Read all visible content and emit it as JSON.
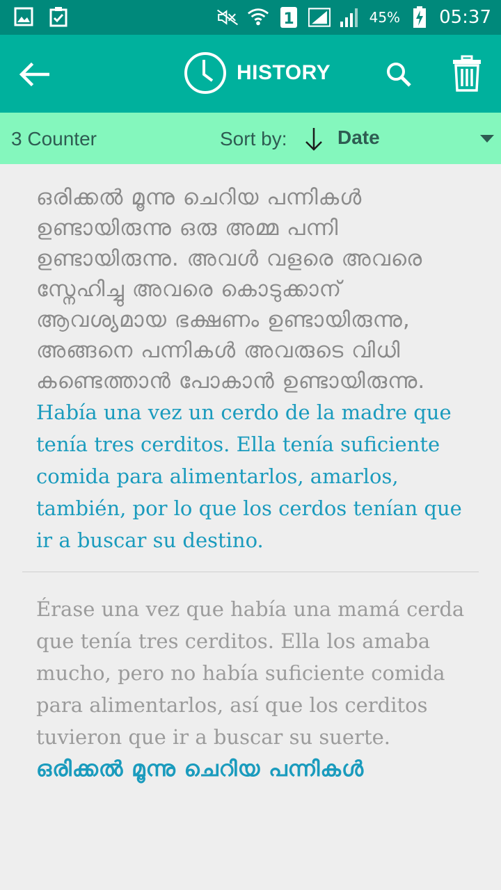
{
  "status_bar": {
    "left_icons": [
      "gallery-icon",
      "clipboard-check-icon"
    ],
    "right_icons": [
      "mute-icon",
      "wifi-icon",
      "sim-1-icon",
      "signal-icon",
      "signal-icon-2",
      "battery-charging-icon"
    ],
    "sim_label": "1",
    "battery": "45%",
    "time": "05:37"
  },
  "app_bar": {
    "title": "HISTORY",
    "icons": {
      "back": "arrow-left-icon",
      "title": "clock-icon",
      "search": "search-icon",
      "delete": "trash-icon"
    }
  },
  "sort_bar": {
    "counter": "3 Counter",
    "sort_label": "Sort by:",
    "sort_direction": "descending",
    "sort_value": "Date"
  },
  "history": [
    {
      "source": "ഒരിക്കൽ മൂന്നു ചെറിയ പന്നികൾ ഉണ്ടായിരുന്നു ഒരു അമ്മ പന്നി ഉണ്ടായിരുന്നു. അവൾ വളരെ അവരെ സ്നേഹിച്ചു അവരെ കൊടുക്കാന് ആവശ്യമായ ഭക്ഷണം ഉണ്ടായിരുന്നു, അങ്ങനെ പന്നികൾ അവരുടെ വിധി കണ്ടെത്താൻ പോകാൻ ഉണ്ടായിരുന്നു.",
      "translation": "Había una vez un cerdo de la madre que tenía tres cerditos. Ella tenía suficiente comida para alimentarlos, amarlos, también, por lo que los cerdos tenían que ir a buscar su destino."
    },
    {
      "source": "Érase una vez que había una mamá cerda que tenía tres cerditos. Ella los amaba mucho, pero no había suficiente comida para alimentarlos, así que los cerditos tuvieron que ir a buscar su suerte.",
      "translation": "ഒരിക്കൽ മൂന്നു ചെറിയ പന്നികൾ"
    }
  ]
}
